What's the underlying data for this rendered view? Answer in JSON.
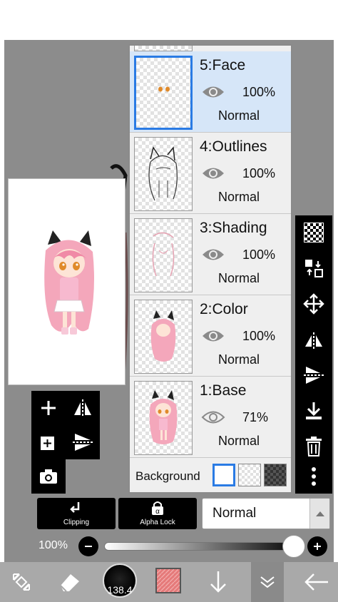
{
  "layers": [
    {
      "name": "5:Face",
      "opacity": "100%",
      "mode": "Normal",
      "selected": true
    },
    {
      "name": "4:Outlines",
      "opacity": "100%",
      "mode": "Normal",
      "selected": false
    },
    {
      "name": "3:Shading",
      "opacity": "100%",
      "mode": "Normal",
      "selected": false
    },
    {
      "name": "2:Color",
      "opacity": "100%",
      "mode": "Normal",
      "selected": false
    },
    {
      "name": "1:Base",
      "opacity": "71%",
      "mode": "Normal",
      "selected": false
    }
  ],
  "background": {
    "label": "Background"
  },
  "mode_buttons": {
    "clipping": "Clipping",
    "alpha_lock": "Alpha Lock"
  },
  "blend_mode": {
    "value": "Normal"
  },
  "opacity": {
    "label": "100%",
    "value": 1.0
  },
  "brush": {
    "size": "138.4"
  },
  "colors": {
    "accent": "#2a7be4",
    "current_color": "#e57a7a",
    "character_hair": "#f4a7bb"
  },
  "icons": {
    "add": "plus-icon",
    "flip_horizontal": "flip-horizontal-icon",
    "add_layer": "add-layer-icon",
    "flip_vertical": "flip-vertical-icon",
    "camera": "camera-icon",
    "transparency": "checkerboard-icon",
    "transfer": "transfer-icon",
    "move": "move-icon",
    "merge_down": "merge-down-icon",
    "delete": "trash-icon",
    "more": "more-vertical-icon",
    "transform": "transform-icon",
    "eraser": "eraser-icon",
    "down": "arrow-down-icon",
    "collapse": "chevron-down-icon",
    "back": "arrow-left-icon"
  }
}
